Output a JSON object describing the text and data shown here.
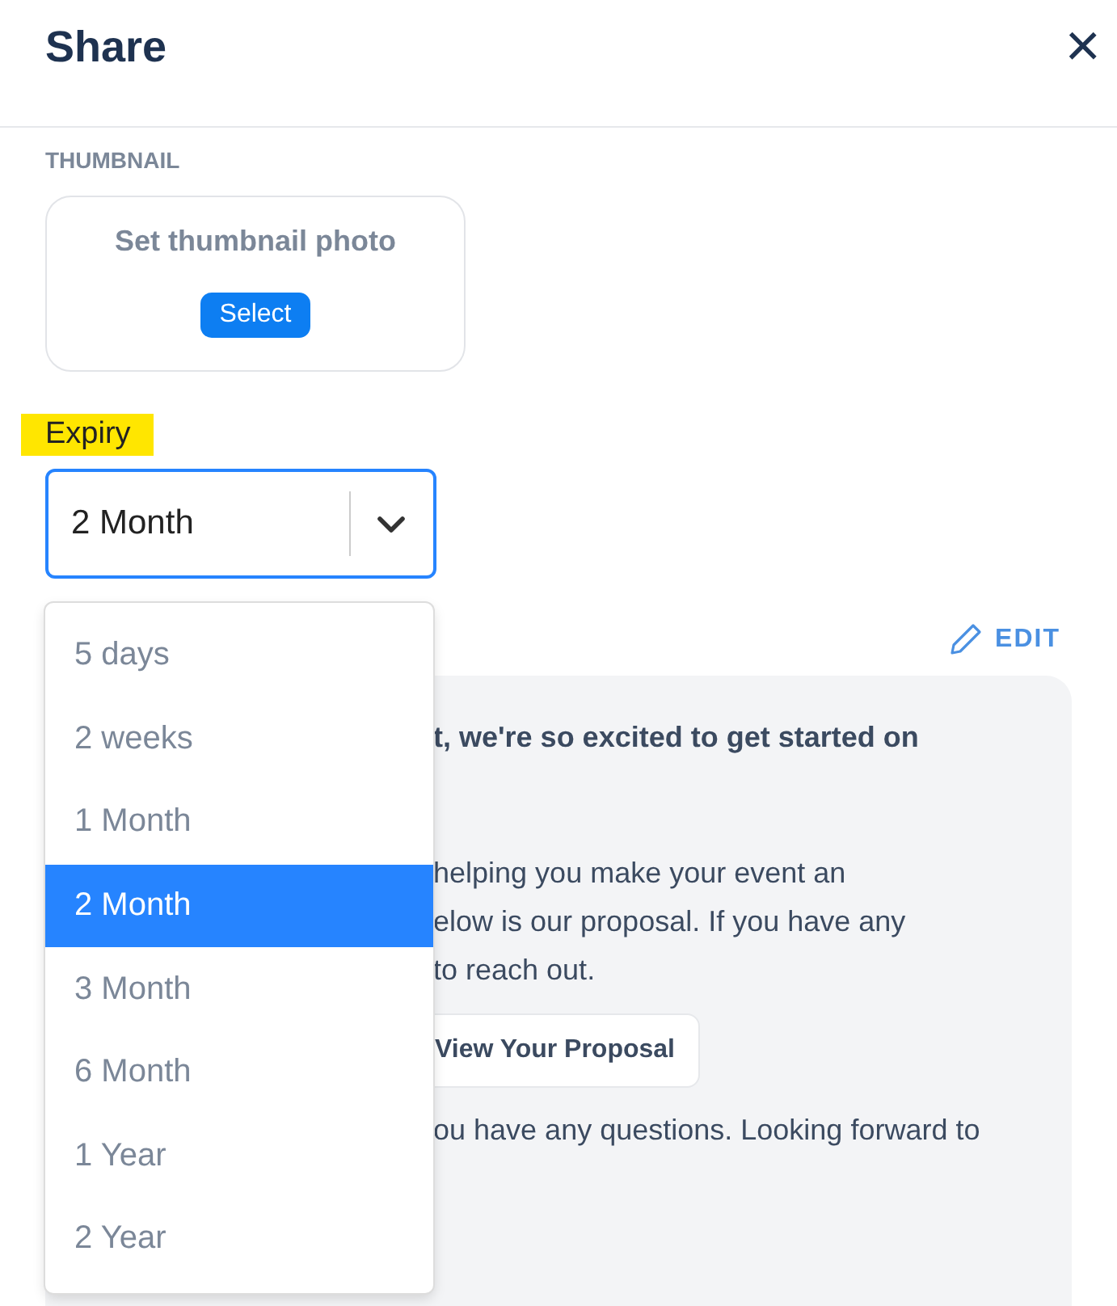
{
  "header": {
    "title": "Share",
    "close": "×"
  },
  "thumbnail": {
    "label": "THUMBNAIL",
    "prompt": "Set thumbnail photo",
    "button": "Select"
  },
  "expiry": {
    "label": "Expiry",
    "value": "2 Month",
    "expanded": true,
    "options": [
      {
        "label": "5 days",
        "selected": false
      },
      {
        "label": "2 weeks",
        "selected": false
      },
      {
        "label": "1 Month",
        "selected": false
      },
      {
        "label": "2 Month",
        "selected": true
      },
      {
        "label": "3 Month",
        "selected": false
      },
      {
        "label": "6 Month",
        "selected": false
      },
      {
        "label": "1 Year",
        "selected": false
      },
      {
        "label": "2 Year",
        "selected": false
      }
    ]
  },
  "message": {
    "edit": "EDIT",
    "heading": "t, we're so excited to get started on",
    "lines": [
      "helping you make your event an",
      "elow is our proposal. If you have any",
      "to reach out."
    ],
    "button": "View Your Proposal",
    "closing": "ou have any questions. Looking forward to"
  }
}
